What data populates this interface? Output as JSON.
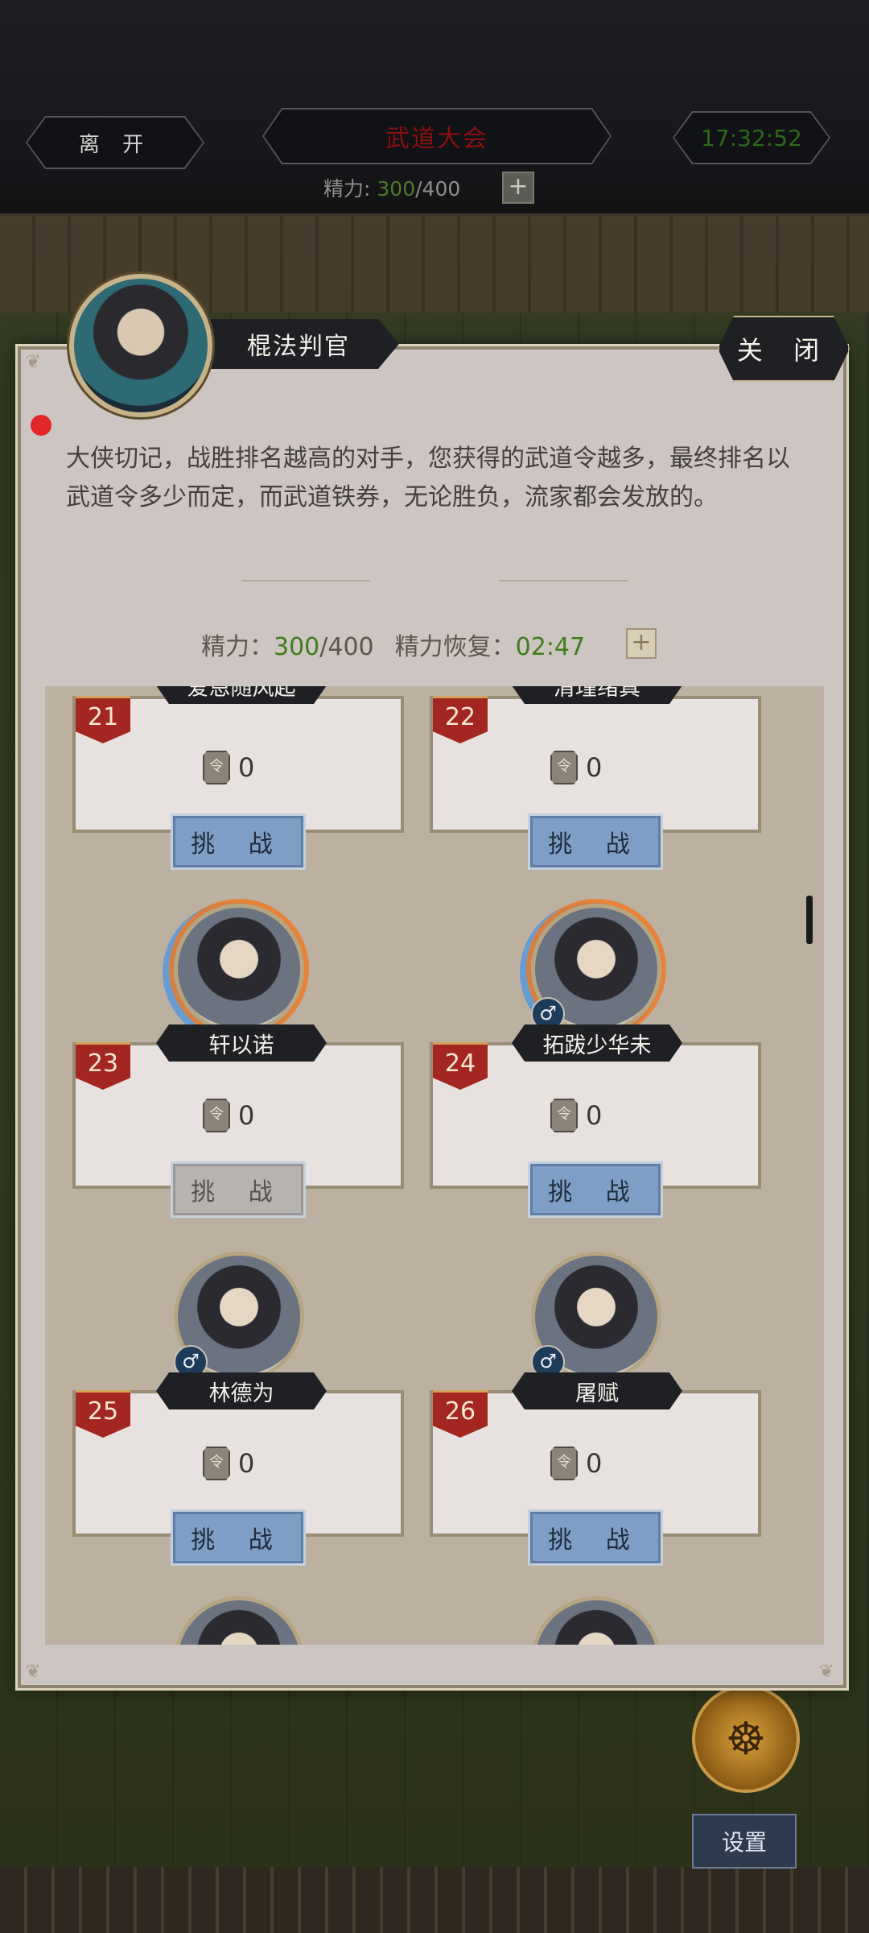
{
  "topbar": {
    "leave_label": "离 开",
    "title": "武道大会",
    "time": "17:32:52",
    "energy_label": "精力:",
    "energy_value": "300",
    "energy_max": "/400",
    "plus": "+"
  },
  "dialog": {
    "npc_name": "棍法判官",
    "close_label": "关 闭",
    "description": "大侠切记，战胜排名越高的对手，您获得的武道令越多，最终排名以武道令多少而定，而武道铁券，无论胜负，流家都会发放的。",
    "energy_label": "精力：",
    "energy_value": "300",
    "energy_max": "/400",
    "recover_label": "精力恢复：",
    "recover_time": "02:47",
    "plus": "+"
  },
  "opponents": [
    {
      "rank": "21",
      "name": "爱恩随风起",
      "tokens": "0",
      "challenge": "挑 战",
      "enabled": true
    },
    {
      "rank": "22",
      "name": "清瑾绪真",
      "tokens": "0",
      "challenge": "挑 战",
      "enabled": true
    },
    {
      "rank": "23",
      "name": "轩以诺",
      "tokens": "0",
      "challenge": "挑 战",
      "enabled": false
    },
    {
      "rank": "24",
      "name": "拓跋少华未",
      "tokens": "0",
      "challenge": "挑 战",
      "enabled": true
    },
    {
      "rank": "25",
      "name": "林德为",
      "tokens": "0",
      "challenge": "挑 战",
      "enabled": true
    },
    {
      "rank": "26",
      "name": "屠赋",
      "tokens": "0",
      "challenge": "挑 战",
      "enabled": true
    }
  ],
  "icons": {
    "token": "令",
    "male": "♂"
  },
  "footer": {
    "settings_label": "设置"
  },
  "colors": {
    "accent_green": "#3f7d1e",
    "title_red": "#8a1010",
    "rank_red": "#a32720",
    "button_blue": "#7e9ec6"
  }
}
